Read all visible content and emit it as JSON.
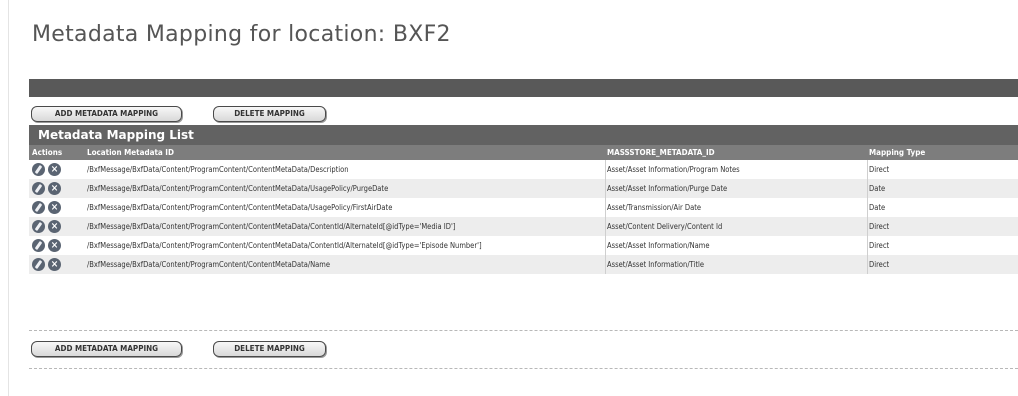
{
  "page": {
    "title": "Metadata Mapping for location: BXF2"
  },
  "toolbar": {
    "add_label": "ADD METADATA MAPPING",
    "delete_label": "DELETE MAPPING"
  },
  "list": {
    "header": "Metadata Mapping List",
    "columns": {
      "actions": "Actions",
      "location_id": "Location Metadata ID",
      "massstore_id": "MASSSTORE_METADATA_ID",
      "mapping_type": "Mapping Type"
    },
    "rows": [
      {
        "location_id": "/BxfMessage/BxfData/Content/ProgramContent/ContentMetaData/Description",
        "massstore_id": "Asset/Asset Information/Program Notes",
        "mapping_type": "Direct"
      },
      {
        "location_id": "/BxfMessage/BxfData/Content/ProgramContent/ContentMetaData/UsagePolicy/PurgeDate",
        "massstore_id": "Asset/Asset Information/Purge Date",
        "mapping_type": "Date"
      },
      {
        "location_id": "/BxfMessage/BxfData/Content/ProgramContent/ContentMetaData/UsagePolicy/FirstAirDate",
        "massstore_id": "Asset/Transmission/Air Date",
        "mapping_type": "Date"
      },
      {
        "location_id": "/BxfMessage/BxfData/Content/ProgramContent/ContentMetaData/ContentId/AlternateId[@idType='Media ID']",
        "massstore_id": "Asset/Content Delivery/Content Id",
        "mapping_type": "Direct"
      },
      {
        "location_id": "/BxfMessage/BxfData/Content/ProgramContent/ContentMetaData/ContentId/AlternateId[@idType='Episode Number']",
        "massstore_id": "Asset/Asset Information/Name",
        "mapping_type": "Direct"
      },
      {
        "location_id": "/BxfMessage/BxfData/Content/ProgramContent/ContentMetaData/Name",
        "massstore_id": "Asset/Asset Information/Title",
        "mapping_type": "Direct"
      }
    ]
  },
  "icons": {
    "edit": "pencil-edit-icon",
    "delete": "delete-x-icon"
  }
}
